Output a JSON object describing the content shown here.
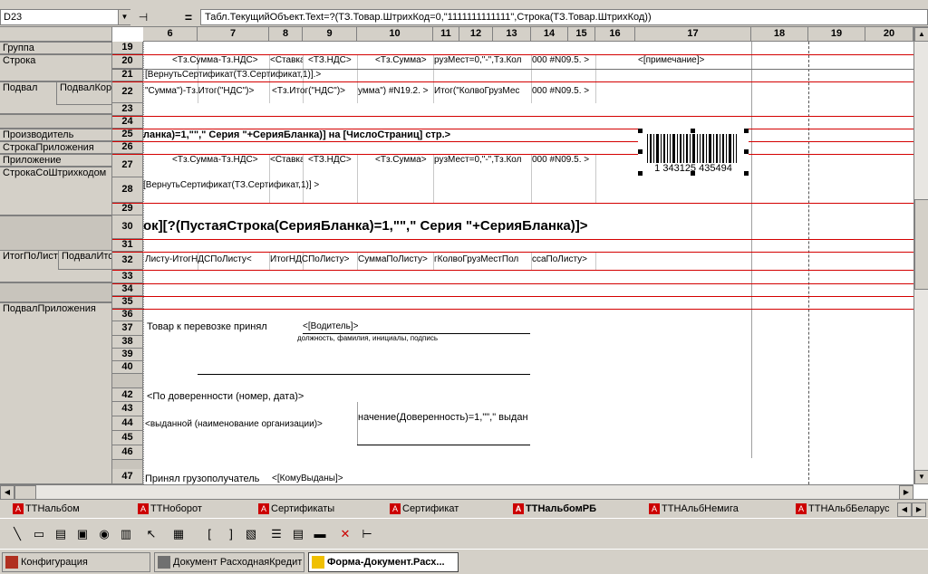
{
  "toolbar_top": {
    "visible": "partial"
  },
  "formula_bar": {
    "cell_ref": "D23",
    "pin_icon": "pin-icon",
    "equals": "=",
    "formula": "Табл.ТекущийОбъект.Text=?(ТЗ.Товар.ШтрихКод=0,\"1111111111111\",Строка(ТЗ.Товар.ШтрихКод))"
  },
  "columns": [
    "6",
    "7",
    "8",
    "9",
    "10",
    "11",
    "12",
    "13",
    "14",
    "15",
    "16",
    "17",
    "18",
    "19",
    "20"
  ],
  "rows": [
    "19",
    "20",
    "21",
    "22",
    "23",
    "24",
    "25",
    "26",
    "27",
    "28",
    "29",
    "30",
    "31",
    "32",
    "33",
    "34",
    "35",
    "36",
    "37",
    "38",
    "39",
    "40",
    "42",
    "43",
    "44",
    "45",
    "46",
    "47"
  ],
  "sections": {
    "gruppa": "Группа",
    "stroka": "Строка",
    "podval": "Подвал",
    "podval_kor": "ПодвалКор",
    "proizvoditel": "Производитель",
    "stroka_prilozheniya": "СтрокаПриложения",
    "prilozhenie": "Приложение",
    "stroka_so_shtrihkodom": "СтрокаСоШтрихкодом",
    "itog_po_listu": "ИтогПоЛисту",
    "podval_itog": "ПодвалИтог",
    "podval_prilozheniya": "ПодвалПриложения"
  },
  "cells": {
    "r20_c6": "<Тз.Сумма-Тз.НДС>",
    "r20_c7": "<Ставка",
    "r20_c8": "<ТЗ.НДС>",
    "r20_c10": "<Тз.Сумма>",
    "r20_c11": "рузМест=0,\"-\",Тз.Кол",
    "r20_c14": "000 #N09.5. >",
    "r20_c17": "<[примечание]>",
    "r21": "[ВернутьСертификат(ТЗ.Сертификат,1)].>",
    "r22_c6": "\"Сумма\")-Тз.Итог(\"НДС\")>",
    "r22_c8": "<Тз.Итог(\"НДС\")>",
    "r22_c10": "умма\") #N19.2. >",
    "r22_c11": "Итог(\"КолвоГрузМес",
    "r22_c14": "000 #N09.5. >",
    "r25": "ланка)=1,\"\",\" Серия \"+СерияБланка)]  на [ЧислоСтраниц] стр.>",
    "r27_c6": "<Тз.Сумма-Тз.НДС>",
    "r27_c7": "<Ставкан",
    "r27_c8": "<ТЗ.НДС>",
    "r27_c10": "<Тз.Сумма>",
    "r27_c11": "рузМест=0,\"-\",Тз.Кол",
    "r27_c14": "000 #N09.5. >",
    "r28": "[ВернутьСертификат(ТЗ.Сертификат,1)] >",
    "r30": "ок][?(ПустаяСтрока(СерияБланка)=1,\"\",\" Серия \"+СерияБланка)]>",
    "r32_c6": "Листу-ИтогНДСПоЛисту<",
    "r32_c8": "ИтогНДСПоЛисту>",
    "r32_c10": "СуммаПоЛисту>",
    "r32_c11": "гКолвоГрузМестПол",
    "r32_c14": "ссаПоЛисту>",
    "r37_a": "Товар к перевозке принял",
    "r37_b": "<[Водитель]>",
    "r38": "должность, фамилия, инициалы, подпись",
    "r42": "<По доверенности (номер, дата)>",
    "r43_44_right": "начение(Доверенность)=1,\"\",\" выдан",
    "r44": "<выданной (наименование организации)>",
    "r47_a": "Принял грузополучатель",
    "r47_b": "<[КомуВыданы]>"
  },
  "barcode": {
    "digits": "1  343125  435494"
  },
  "sheet_tabs": [
    {
      "label": "ТТНальбом",
      "active": false
    },
    {
      "label": "ТТНоборот",
      "active": false
    },
    {
      "label": "Сертификаты",
      "active": false
    },
    {
      "label": "Сертификат",
      "active": false
    },
    {
      "label": "ТТНальбомРБ",
      "active": true
    },
    {
      "label": "ТТНАльбНемига",
      "active": false
    },
    {
      "label": "ТТНАльбБеларус",
      "active": false
    }
  ],
  "draw_tools": [
    "line-icon",
    "rectangle-icon",
    "text-icon",
    "picture-icon",
    "ole-icon",
    "chart-icon",
    "pointer-icon",
    "grid-icon",
    "bracket-left-icon",
    "bracket-right-icon",
    "table-icon",
    "layout-icon",
    "column-icon",
    "delete-icon",
    "format-icon"
  ],
  "taskbar": [
    {
      "label": "Конфигурация",
      "active": false
    },
    {
      "label": "Документ РасходнаяКредит",
      "active": false
    },
    {
      "label": "Форма-Документ.Расх...",
      "active": true
    }
  ],
  "colors": {
    "section_line": "#d40000",
    "chrome": "#d4d0c8"
  }
}
